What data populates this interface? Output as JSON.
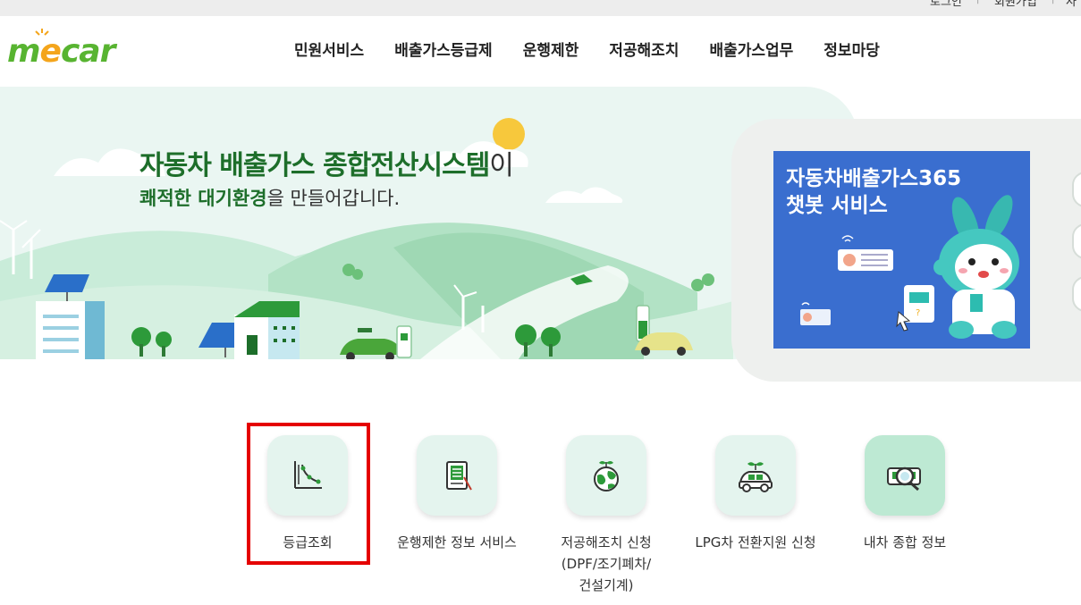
{
  "top_util": {
    "login": "로그인",
    "join": "회원가입",
    "more": "사"
  },
  "logo": {
    "text_m": "m",
    "text_e": "e",
    "text_car": "car"
  },
  "nav": {
    "items": [
      {
        "label": "민원서비스"
      },
      {
        "label": "배출가스등급제"
      },
      {
        "label": "운행제한"
      },
      {
        "label": "저공해조치"
      },
      {
        "label": "배출가스업무"
      },
      {
        "label": "정보마당"
      }
    ]
  },
  "hero": {
    "title_green": "자동차 배출가스 종합전산시스템",
    "title_suffix": "이",
    "sub_green": "쾌적한 대기환경",
    "sub_rest": "을 만들어갑니다."
  },
  "promo": {
    "line1": "자동차배출가스365",
    "line2": "챗봇 서비스"
  },
  "services": [
    {
      "label": "등급조회",
      "icon": "graph-icon"
    },
    {
      "label": "운행제한 정보 서비스",
      "icon": "document-icon"
    },
    {
      "label": "저공해조치 신청\n(DPF/조기폐차/\n건설기계)",
      "icon": "earth-sprout-icon"
    },
    {
      "label": "LPG차 전환지원 신청",
      "icon": "car-sprout-icon"
    },
    {
      "label": "내차 종합 정보",
      "icon": "car-search-icon"
    }
  ],
  "colors": {
    "brand_green": "#1d6e2a",
    "logo_green": "#58b431",
    "logo_orange": "#f4a51c",
    "hero_bg": "#eaf6f2",
    "tile_bg": "#e4f4ee",
    "chatbot_blue": "#3a6ecf",
    "highlight_red": "#e50000"
  }
}
